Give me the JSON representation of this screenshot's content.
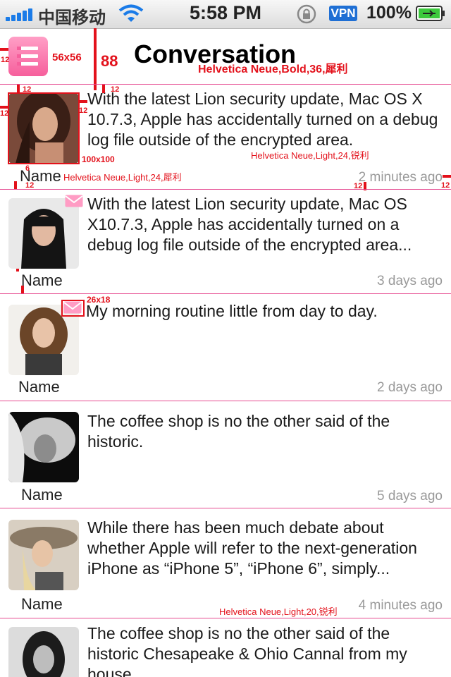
{
  "status_bar": {
    "carrier": "中国移动",
    "time": "5:58 PM",
    "vpn": "VPN",
    "battery": "100%"
  },
  "header": {
    "title": "Conversation",
    "menu_icon": "list-menu-icon"
  },
  "annotations": {
    "menu_size": "56x56",
    "header_height": "88",
    "title_font": "Helvetica Neue,Bold,36,犀利",
    "avatar_size": "100x100",
    "message_font": "Helvetica Neue,Light,24,锐利",
    "name_font": "Helvetica Neue,Light,24,犀利",
    "mail_size": "26x18",
    "time_font": "Helvetica Neue,Light,20,锐利",
    "m12": "12",
    "m6": "6"
  },
  "conversations": [
    {
      "message": "With the latest Lion security update, Mac OS X 10.7.3, Apple has accidentally turned on a debug log file outside of the encrypted area.",
      "name": "Name",
      "time": "2 minutes ago",
      "unread": false
    },
    {
      "message": "With the latest Lion security update, Mac OS X10.7.3, Apple has accidentally turned on a debug log file outside of the encrypted area...",
      "name": "Name",
      "time": "3 days ago",
      "unread": true
    },
    {
      "message": "My morning routine little from day to day.",
      "name": "Name",
      "time": "2 days ago",
      "unread": true
    },
    {
      "message": "The coffee shop is no the other said of the historic.",
      "name": "Name",
      "time": "5 days ago",
      "unread": false
    },
    {
      "message": "While there has been much debate about whether Apple will refer to the next-generation iPhone as “iPhone 5”, “iPhone 6”, simply...",
      "name": "Name",
      "time": "4 minutes ago",
      "unread": false
    },
    {
      "message": "The coffee shop is no the other said of the historic Chesapeake & Ohio Cannal from my house.",
      "name": "",
      "time": "",
      "unread": false
    }
  ],
  "colors": {
    "accent": "#f65f9c",
    "divider": "#e64c91",
    "annotation": "#e3111b",
    "time_text": "#999999"
  }
}
